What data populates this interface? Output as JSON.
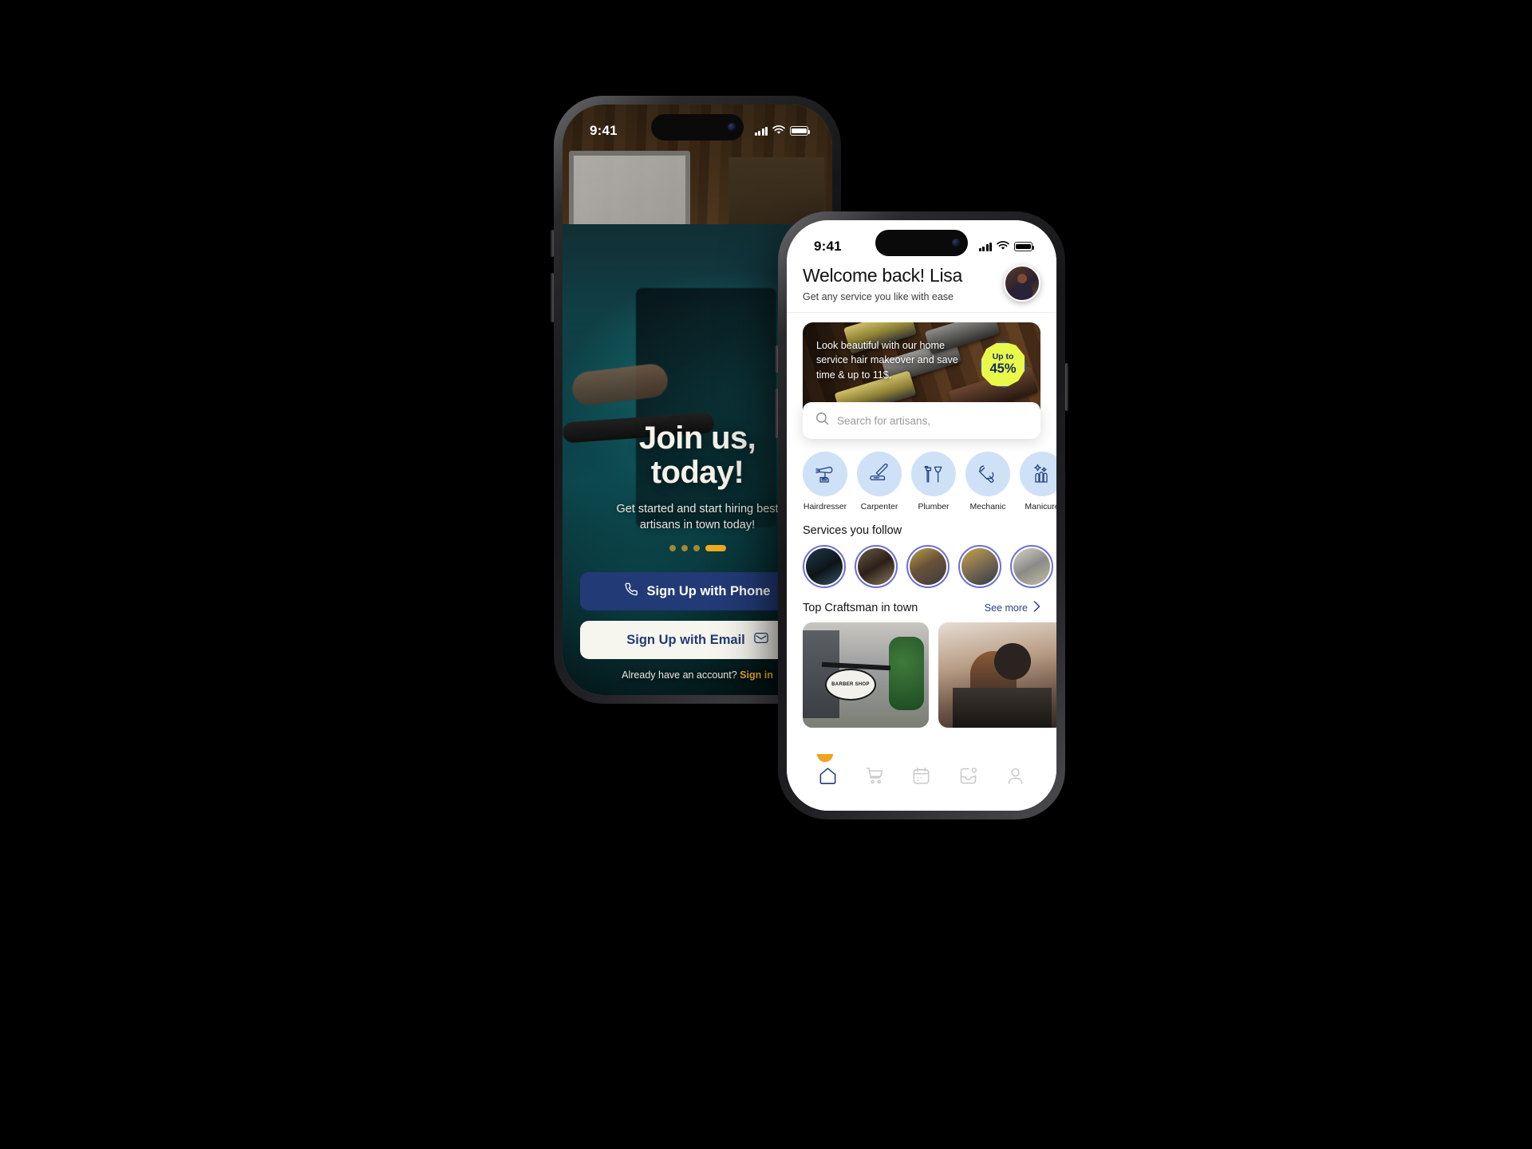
{
  "scene": {
    "background": "#000000"
  },
  "theme": {
    "primary_blue": "#223a76",
    "accent_orange": "#eeab1e",
    "badge_yellow": "#e9f94a",
    "icon_blue_bg": "#cfe1f7",
    "ring_purple": "#6b6fd6"
  },
  "onboarding": {
    "status": {
      "time": "9:41",
      "signal": "signal-bars",
      "wifi": "wifi",
      "battery": "battery-full"
    },
    "title_line1": "Join us,",
    "title_line2": "today!",
    "subtitle_line1": "Get started and start hiring best",
    "subtitle_line2": "artisans in town today!",
    "pager": {
      "count": 4,
      "active_index": 3
    },
    "buttons": {
      "phone_label": "Sign Up with Phone",
      "email_label": "Sign Up with Email"
    },
    "account_prompt": "Already have an account? ",
    "account_link": "Sign in"
  },
  "home": {
    "status": {
      "time": "9:41",
      "signal": "signal-bars",
      "wifi": "wifi",
      "battery": "battery-full"
    },
    "header": {
      "title": "Welcome back! Lisa",
      "subtitle": "Get any service you like with ease",
      "avatar": "user-avatar"
    },
    "promo": {
      "text": "Look beautiful with our home service hair makeover and save time & up to 11$.",
      "badge_small": "Up to",
      "badge_big": "45%"
    },
    "search": {
      "placeholder": "Search for artisans,",
      "icon": "search-icon"
    },
    "categories": [
      {
        "label": "Hairdresser",
        "icon": "hairdryer-icon"
      },
      {
        "label": "Carpenter",
        "icon": "plane-tool-icon"
      },
      {
        "label": "Plumber",
        "icon": "wrench-plunger-icon"
      },
      {
        "label": "Mechanic",
        "icon": "wrench-hand-icon"
      },
      {
        "label": "Manicure",
        "icon": "nail-polish-icon"
      }
    ],
    "follow_section": {
      "title": "Services you follow",
      "count": 5
    },
    "top_section": {
      "title": "Top Craftsman in town",
      "see_more": "See more",
      "chevron": "chevron-right-icon"
    },
    "cards": [
      {
        "name": "barber-shop-storefront"
      },
      {
        "name": "barber-cutting-hair"
      }
    ],
    "tabs": [
      {
        "name": "home",
        "icon": "home-icon",
        "active": true
      },
      {
        "name": "cart",
        "icon": "cart-icon",
        "active": false
      },
      {
        "name": "calendar",
        "icon": "calendar-icon",
        "active": false
      },
      {
        "name": "inbox",
        "icon": "inbox-icon",
        "active": false
      },
      {
        "name": "profile",
        "icon": "person-icon",
        "active": false
      }
    ]
  }
}
